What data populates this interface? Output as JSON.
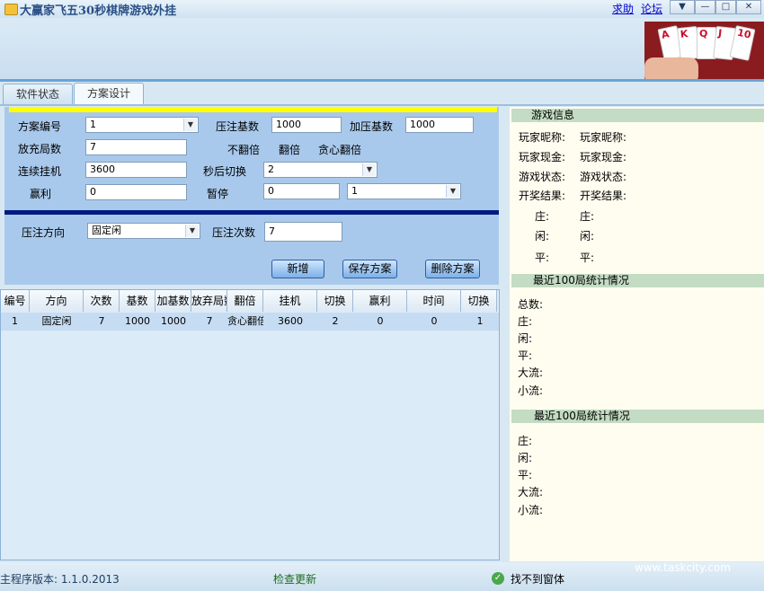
{
  "window": {
    "title": "大赢家飞五30秒棋牌游戏外挂",
    "links": {
      "help": "求助",
      "forum": "论坛"
    },
    "controls": {
      "menu": "▼",
      "minimize": "—",
      "maximize": "□",
      "close": "✕"
    }
  },
  "tabs": [
    {
      "label": "软件状态",
      "active": false
    },
    {
      "label": "方案设计",
      "active": true
    }
  ],
  "form": {
    "plan_no_label": "方案编号",
    "plan_no_value": "1",
    "bet_base_label": "压注基数",
    "bet_base_value": "1000",
    "add_base_label": "加压基数",
    "add_base_value": "1000",
    "fill_rounds_label": "放充局数",
    "fill_rounds_value": "7",
    "opt_no_double": "不翻倍",
    "opt_double": "翻倍",
    "opt_greedy_double": "贪心翻倍",
    "continuous_label": "连续挂机",
    "continuous_value": "3600",
    "switch_after_label": "秒后切换",
    "switch_after_value": "2",
    "profit_label": "赢利",
    "profit_value": "0",
    "pause_label": "暂停",
    "pause_value": "0",
    "pause_select": "1",
    "direction_label": "压注方向",
    "direction_value": "固定闲",
    "bet_count_label": "压注次数",
    "bet_count_value": "7"
  },
  "buttons": {
    "add": "新增",
    "save": "保存方案",
    "delete": "删除方案"
  },
  "table": {
    "headers": [
      "编号",
      "方向",
      "次数",
      "基数",
      "加基数",
      "放弃局数",
      "翻倍",
      "挂机",
      "切换",
      "赢利",
      "时间",
      "切换"
    ],
    "rows": [
      [
        "1",
        "固定闲",
        "7",
        "1000",
        "1000",
        "7",
        "贪心翻倍",
        "3600",
        "2",
        "0",
        "0",
        "1"
      ]
    ]
  },
  "right": {
    "game_info_title": "游戏信息",
    "game_info": [
      {
        "label": "玩家昵称:",
        "value": "玩家昵称:"
      },
      {
        "label": "玩家现金:",
        "value": "玩家现金:"
      },
      {
        "label": "游戏状态:",
        "value": "游戏状态:"
      },
      {
        "label": "开奖结果:",
        "value": "开奖结果:"
      },
      {
        "label": "庄:",
        "value": "庄:"
      },
      {
        "label": "闲:",
        "value": "闲:"
      },
      {
        "label": "平:",
        "value": "平:"
      }
    ],
    "stats1_title": "最近100局统计情况",
    "stats1": [
      "总数:",
      "庄:",
      "闲:",
      "平:",
      "大流:",
      "小流:"
    ],
    "stats2_title": "最近100局统计情况",
    "stats2": [
      "庄:",
      "闲:",
      "平:",
      "大流:",
      "小流:"
    ]
  },
  "status": {
    "version": "主程序版本: 1.1.0.2013",
    "update": "检查更新",
    "window_status": "找不到窗体",
    "watermark": "www.taskcity.com"
  }
}
